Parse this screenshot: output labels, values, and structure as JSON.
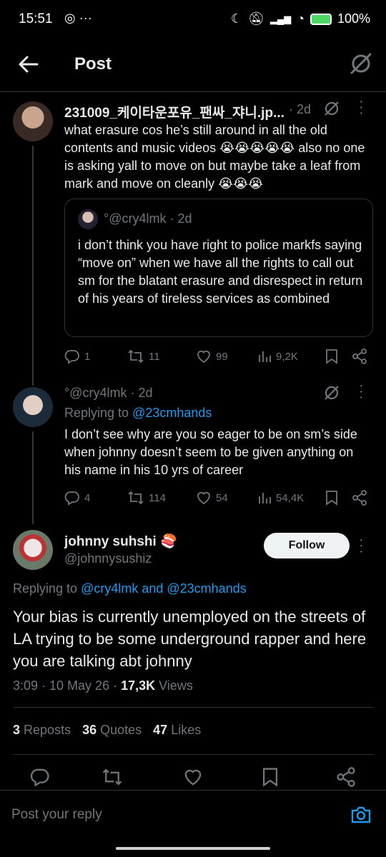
{
  "status_bar": {
    "time": "15:51",
    "battery": "100%"
  },
  "header": {
    "title": "Post"
  },
  "tweet1": {
    "name": "231009_케이타운포유_팬싸_쟈니.jp...",
    "time": "2d",
    "text": "what erasure cos he’s still around in all the old contents and music videos 😭😭😭😭😭 also no one is asking yall to move on but maybe take a leaf from mark and move on cleanly 😭😭😭",
    "quote": {
      "handle": "°@cry4lmk",
      "time": "2d",
      "text": "i don’t think you have right to police markfs saying “move on” when we have all the rights to call out sm for the blatant erasure and disrespect in return of his years of tireless services as combined"
    },
    "replies": "1",
    "reposts": "11",
    "likes": "99",
    "views": "9,2K"
  },
  "tweet2": {
    "handle": "°@cry4lmk",
    "time": "2d",
    "replying_prefix": "Replying to",
    "replying_to": "@23cmhands",
    "text": "I don’t see why are you so eager to be on sm’s side when johnny doesn’t seem to be given anything on his name in his 10 yrs of career",
    "replies": "4",
    "reposts": "114",
    "likes": "54",
    "views": "54,4K"
  },
  "main": {
    "name": "johnny suhshi 🍣",
    "handle": "@johnnysushiz",
    "follow_label": "Follow",
    "replying_prefix": "Replying to",
    "replying_to": "@cry4lmk and @23cmhands",
    "text": "Your bias is currently unemployed on the streets of LA trying to be some underground rapper and here you are talking abt johnny",
    "timestamp": "3:09 · 10 May 26 · ",
    "views_count": "17,3K",
    "views_label": " Views",
    "reposts_count": "3",
    "reposts_label": "Reposts",
    "quotes_count": "36",
    "quotes_label": "Quotes",
    "likes_count": "47",
    "likes_label": "Likes"
  },
  "reply_bar": {
    "placeholder": "Post your reply"
  },
  "colors": {
    "accent": "#1d9bf0",
    "background": "#000000",
    "muted": "#71767b",
    "divider": "#2f3336"
  }
}
